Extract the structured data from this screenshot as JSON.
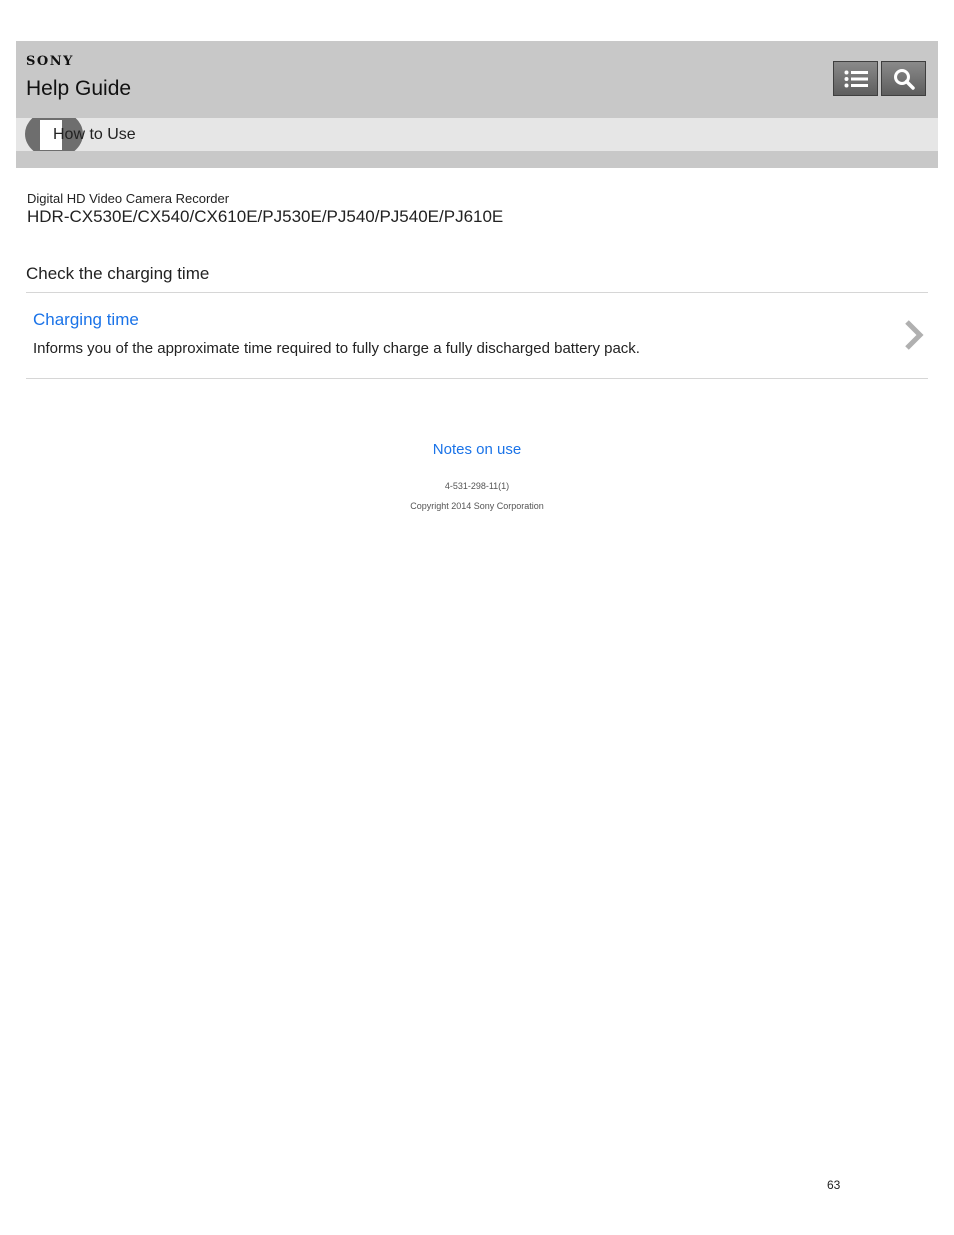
{
  "header": {
    "brand": "SONY",
    "title": "Help Guide",
    "toc_button": {
      "icon": "list-icon"
    },
    "search_button": {
      "icon": "search-icon"
    }
  },
  "nav": {
    "icon": "how-to-use-icon",
    "label": "How to Use"
  },
  "product": {
    "category": "Digital HD Video Camera Recorder",
    "models": "HDR-CX530E/CX540/CX610E/PJ530E/PJ540/PJ540E/PJ610E"
  },
  "main": {
    "heading": "Check the charging time",
    "topics": [
      {
        "title": "Charging time",
        "description": "Informs you of the approximate time required to fully charge a fully discharged battery pack.",
        "icon": "chevron-right-icon"
      }
    ]
  },
  "footer": {
    "link": "Notes on use",
    "doc_number": "4-531-298-11(1)",
    "copyright": "Copyright 2014 Sony Corporation"
  },
  "page_number": "63",
  "colors": {
    "header_bg": "#c8c8c8",
    "nav_bg": "#e6e6e6",
    "link": "#1a73e8"
  }
}
